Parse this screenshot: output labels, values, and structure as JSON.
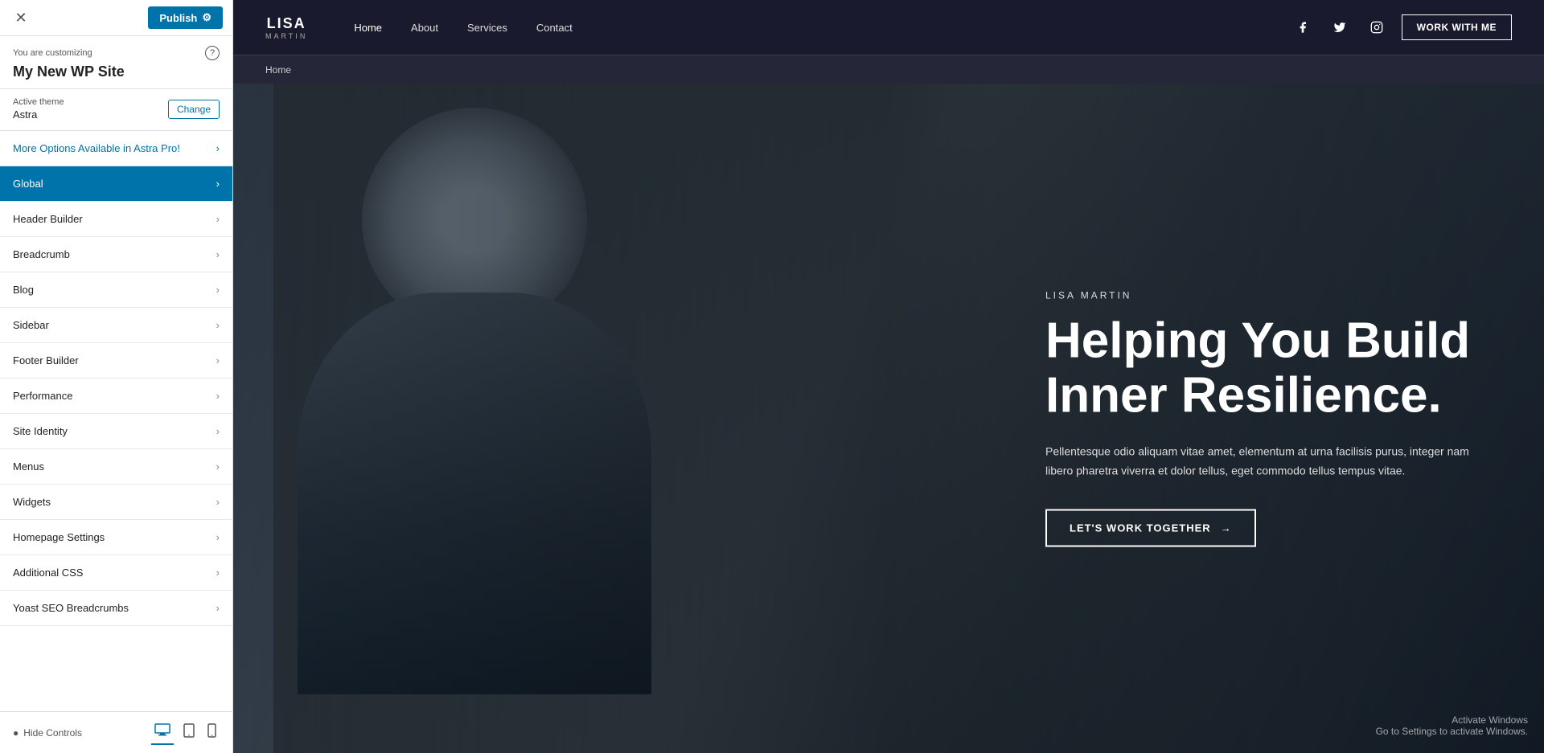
{
  "topbar": {
    "close_icon": "✕",
    "publish_label": "Publish",
    "gear_icon": "⚙"
  },
  "customizing": {
    "label": "You are customizing",
    "site_name": "My New WP Site",
    "help_icon": "?"
  },
  "theme": {
    "label": "Active theme",
    "name": "Astra",
    "change_label": "Change"
  },
  "nav_items": [
    {
      "id": "astra-pro",
      "label": "More Options Available in Astra Pro!",
      "type": "astra-pro"
    },
    {
      "id": "global",
      "label": "Global",
      "type": "highlight"
    },
    {
      "id": "header-builder",
      "label": "Header Builder",
      "type": "normal"
    },
    {
      "id": "breadcrumb",
      "label": "Breadcrumb",
      "type": "normal"
    },
    {
      "id": "blog",
      "label": "Blog",
      "type": "normal"
    },
    {
      "id": "sidebar",
      "label": "Sidebar",
      "type": "normal"
    },
    {
      "id": "footer-builder",
      "label": "Footer Builder",
      "type": "normal"
    },
    {
      "id": "performance",
      "label": "Performance",
      "type": "normal"
    },
    {
      "id": "site-identity",
      "label": "Site Identity",
      "type": "normal"
    },
    {
      "id": "menus",
      "label": "Menus",
      "type": "normal"
    },
    {
      "id": "widgets",
      "label": "Widgets",
      "type": "normal"
    },
    {
      "id": "homepage-settings",
      "label": "Homepage Settings",
      "type": "normal"
    },
    {
      "id": "additional-css",
      "label": "Additional CSS",
      "type": "normal"
    },
    {
      "id": "yoast-seo",
      "label": "Yoast SEO Breadcrumbs",
      "type": "normal"
    }
  ],
  "bottom": {
    "hide_controls": "Hide Controls",
    "eye_icon": "👁",
    "desktop_icon": "🖥",
    "tablet_icon": "📱",
    "mobile_icon": "📱"
  },
  "preview": {
    "logo_name": "LISA",
    "logo_sub": "MARTIN",
    "nav_links": [
      {
        "label": "Home",
        "active": true
      },
      {
        "label": "About",
        "active": false
      },
      {
        "label": "Services",
        "active": false
      },
      {
        "label": "Contact",
        "active": false
      }
    ],
    "social_icons": [
      "facebook",
      "twitter",
      "instagram"
    ],
    "work_with_me": "WORK WITH ME",
    "breadcrumb": "Home",
    "hero": {
      "subtitle": "LISA MARTIN",
      "title_line1": "Helping You Build",
      "title_line2": "Inner Resilience.",
      "description": "Pellentesque odio aliquam vitae amet, elementum at urna facilisis purus, integer nam libero pharetra viverra et dolor tellus, eget commodo tellus tempus vitae.",
      "cta_label": "LET'S WORK TOGETHER",
      "cta_arrow": "→"
    },
    "activate_windows_line1": "Activate Windows",
    "activate_windows_line2": "Go to Settings to activate Windows."
  }
}
